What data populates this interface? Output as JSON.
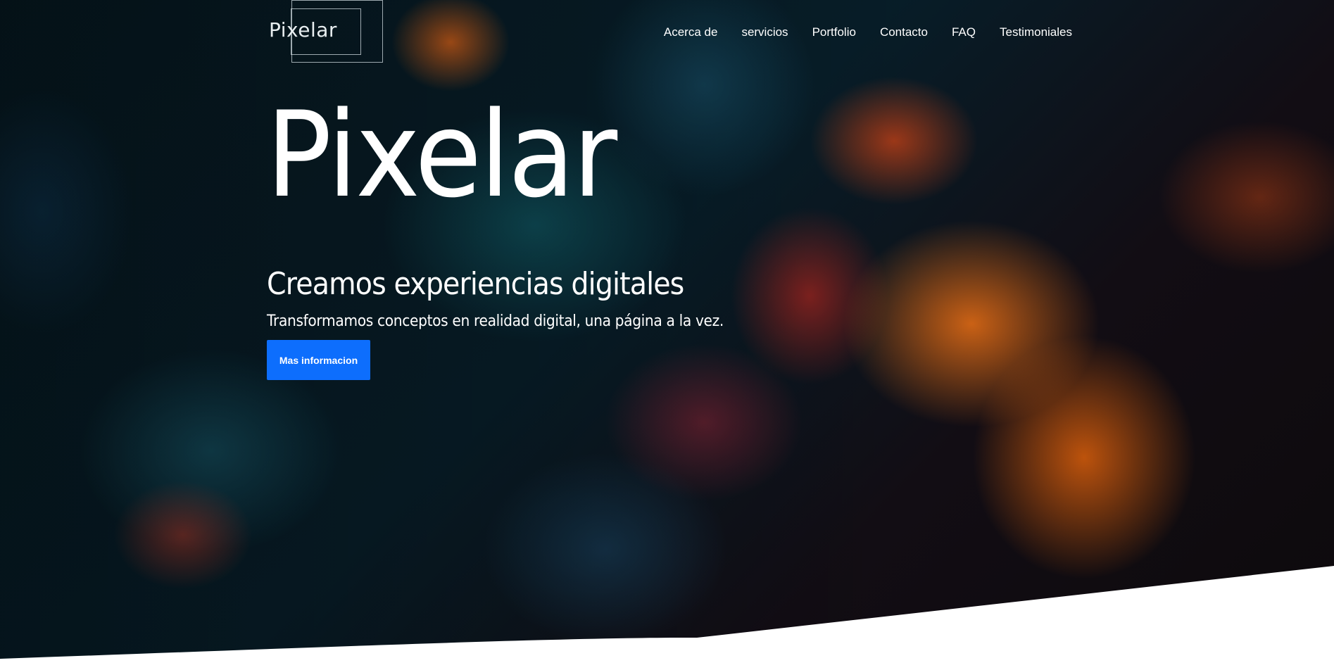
{
  "brand": {
    "logo_text": "Pixelar"
  },
  "nav": {
    "items": [
      {
        "label": "Acerca de"
      },
      {
        "label": "servicios"
      },
      {
        "label": "Portfolio"
      },
      {
        "label": "Contacto"
      },
      {
        "label": "FAQ"
      },
      {
        "label": "Testimoniales"
      }
    ]
  },
  "hero": {
    "title": "Pixelar",
    "subtitle": "Creamos experiencias digitales",
    "tagline": "Transformamos conceptos en realidad digital, una página a la vez.",
    "cta_label": "Mas informacion"
  },
  "colors": {
    "accent": "#0d6efd",
    "text": "#ffffff",
    "background": "#04161d"
  }
}
